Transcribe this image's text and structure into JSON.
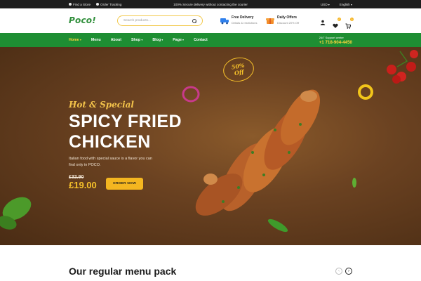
{
  "topbar": {
    "find_store": "Find a Store",
    "order_tracking": "Order Tracking",
    "center_text": "100% Secure delivery without contacting the courier",
    "currency": "USD",
    "language": "English"
  },
  "header": {
    "logo_text": "Poco!",
    "search_placeholder": "Search products...",
    "features": [
      {
        "title": "Free Delivery",
        "subtitle": "Details & restrictions"
      },
      {
        "title": "Daily Offers",
        "subtitle": "Discount 20% Off"
      }
    ],
    "cart_count": "0",
    "wishlist_count": "0"
  },
  "nav": {
    "items": [
      "Home",
      "Menu",
      "About",
      "Shop",
      "Blog",
      "Page",
      "Contact"
    ],
    "support_label": "24/7 Support center",
    "support_phone": "+1 718-904-4450"
  },
  "hero": {
    "kicker": "Hot & Special",
    "title_line1": "SPICY FRIED",
    "title_line2": "CHICKEN",
    "description": "Italian food with special sauce is a flavor you can find only in POCO.",
    "old_price": "£32.90",
    "new_price": "£19.00",
    "cta": "ORDER NOW",
    "badge_line1": "50%",
    "badge_line2": "Off"
  },
  "section": {
    "title": "Our regular menu pack"
  },
  "colors": {
    "brand_green": "#1e8e33",
    "accent_yellow": "#f4b620",
    "dark_bar": "#1d1d1d",
    "hero_brown": "#6b4221"
  }
}
